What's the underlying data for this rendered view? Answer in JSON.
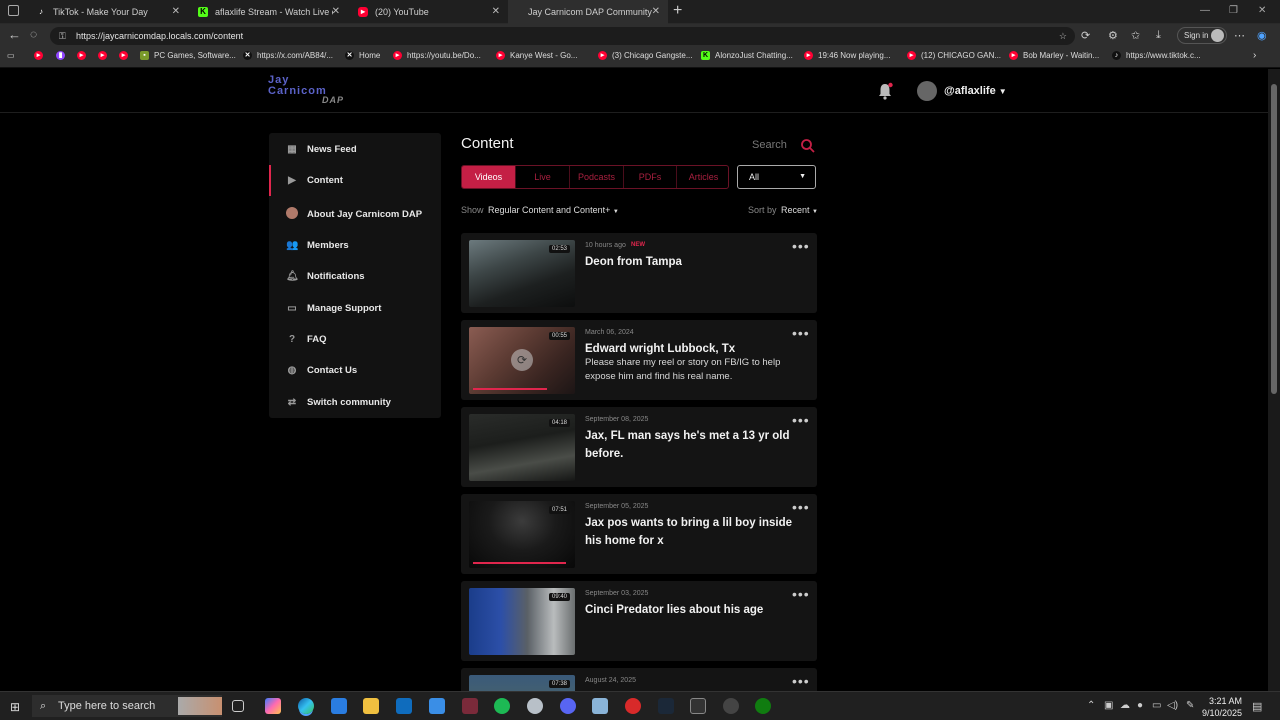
{
  "browser": {
    "tabs": [
      {
        "title": "TikTok - Make Your Day",
        "color": "#111111"
      },
      {
        "title": "aflaxlife Stream - Watch Live on K",
        "color": "#53fc18"
      },
      {
        "title": "(20) YouTube",
        "color": "#ff0033"
      },
      {
        "title": "Jay Carnicom DAP Community",
        "color": "#5b62c8"
      }
    ],
    "new_tab": "+",
    "url": "https://jaycarnicomdap.locals.com/content",
    "sign_in": "Sign in",
    "bookmarks": [
      {
        "label": "",
        "color": "#ff0033"
      },
      {
        "label": "",
        "color": "#9146ff"
      },
      {
        "label": "",
        "color": "#ff0033"
      },
      {
        "label": "",
        "color": "#ff0033"
      },
      {
        "label": "",
        "color": "#ff0033"
      },
      {
        "label": "PC Games, Software...",
        "color": "#7a9a2a"
      },
      {
        "label": "https://x.com/AB84/...",
        "color": "#111111"
      },
      {
        "label": "Home",
        "color": "#111111"
      },
      {
        "label": "https://youtu.be/Do...",
        "color": "#ff0033"
      },
      {
        "label": "Kanye West - Go...",
        "color": "#ff0033"
      },
      {
        "label": "(3) Chicago Gangste...",
        "color": "#ff0033"
      },
      {
        "label": "AlonzoJust Chatting...",
        "color": "#53fc18"
      },
      {
        "label": "19:46 Now playing...",
        "color": "#ff0033"
      },
      {
        "label": "(12) CHICAGO GAN...",
        "color": "#ff0033"
      },
      {
        "label": "Bob Marley - Waitin...",
        "color": "#ff0033"
      },
      {
        "label": "https://www.tiktok.c...",
        "color": "#111111"
      }
    ]
  },
  "site": {
    "logo_line1": "Jay",
    "logo_line2": "Carnicom",
    "logo_line3": "DAP",
    "username": "@aflaxlife",
    "accent": "#e0264d"
  },
  "sidebar": {
    "items": [
      {
        "label": "News Feed",
        "icon": "grid-icon"
      },
      {
        "label": "Content",
        "icon": "play-icon"
      },
      {
        "label": "About Jay Carnicom DAP",
        "icon": "community-avatar-icon"
      },
      {
        "label": "Members",
        "icon": "people-icon"
      },
      {
        "label": "Notifications",
        "icon": "bell-icon"
      },
      {
        "label": "Manage Support",
        "icon": "card-icon"
      },
      {
        "label": "FAQ",
        "icon": "question-icon"
      },
      {
        "label": "Contact Us",
        "icon": "chat-icon"
      },
      {
        "label": "Switch community",
        "icon": "switch-icon"
      }
    ]
  },
  "main": {
    "title": "Content",
    "search_placeholder": "Search",
    "tabs": [
      "Videos",
      "Live",
      "Podcasts",
      "PDFs",
      "Articles"
    ],
    "filter": "All",
    "show_label": "Show",
    "show_value": "Regular Content and Content+",
    "sort_label": "Sort by",
    "sort_value": "Recent",
    "items": [
      {
        "date": "10 hours ago",
        "badge": "NEW",
        "title": "Deon from Tampa",
        "description": "",
        "duration": "02:53",
        "progress": 0
      },
      {
        "date": "March 06, 2024",
        "badge": "",
        "title": "Edward wright Lubbock, Tx",
        "description": "Please share my reel or story on FB/IG to help expose him and find his real name.",
        "duration": "00:55",
        "progress": 0.75
      },
      {
        "date": "September 08, 2025",
        "badge": "",
        "title": "Jax, FL man says he's met a 13 yr old before.",
        "description": "",
        "duration": "04:18",
        "progress": 0
      },
      {
        "date": "September 05, 2025",
        "badge": "",
        "title": "Jax pos wants to bring a lil boy inside his home for x",
        "description": "",
        "duration": "07:51",
        "progress": 0.95
      },
      {
        "date": "September 03, 2025",
        "badge": "",
        "title": "Cinci Predator lies about his age",
        "description": "",
        "duration": "09:40",
        "progress": 0
      },
      {
        "date": "August 24, 2025",
        "badge": "",
        "title": "",
        "description": "",
        "duration": "07:38",
        "progress": 0
      }
    ]
  },
  "taskbar": {
    "search_placeholder": "Type here to search",
    "time": "3:21 AM",
    "date": "9/10/2025"
  }
}
